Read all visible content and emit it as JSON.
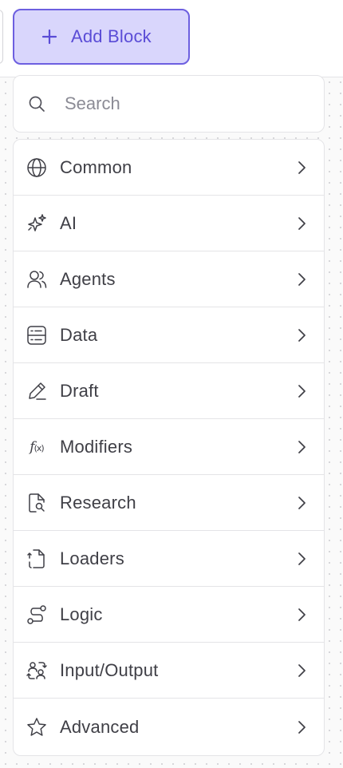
{
  "toolbar": {
    "add_block_label": "Add Block",
    "add_block_icon": "plus-icon",
    "accent_color": "#6d5fe0",
    "accent_bg": "#d9d6fc"
  },
  "search": {
    "placeholder": "Search",
    "value": "",
    "icon": "search-icon"
  },
  "menu": {
    "items": [
      {
        "label": "Common",
        "icon": "globe-icon"
      },
      {
        "label": "AI",
        "icon": "sparkles-icon"
      },
      {
        "label": "Agents",
        "icon": "users-icon"
      },
      {
        "label": "Data",
        "icon": "database-icon"
      },
      {
        "label": "Draft",
        "icon": "pencil-icon"
      },
      {
        "label": "Modifiers",
        "icon": "function-icon"
      },
      {
        "label": "Research",
        "icon": "file-search-icon"
      },
      {
        "label": "Loaders",
        "icon": "file-loader-icon"
      },
      {
        "label": "Logic",
        "icon": "route-icon"
      },
      {
        "label": "Input/Output",
        "icon": "input-output-icon"
      },
      {
        "label": "Advanced",
        "icon": "star-icon"
      }
    ],
    "chevron_icon": "chevron-right-icon"
  }
}
